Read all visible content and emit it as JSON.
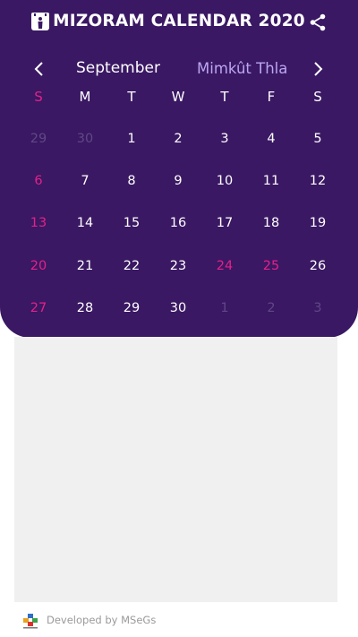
{
  "app": {
    "title": "MIZORAM CALENDAR 2020"
  },
  "nav": {
    "month_en": "September",
    "month_mz": "Mimkût Thla"
  },
  "weekdays": [
    "S",
    "M",
    "T",
    "W",
    "T",
    "F",
    "S"
  ],
  "weeks": [
    [
      {
        "d": "29",
        "t": "other"
      },
      {
        "d": "30",
        "t": "other"
      },
      {
        "d": "1",
        "t": "normal"
      },
      {
        "d": "2",
        "t": "normal"
      },
      {
        "d": "3",
        "t": "normal"
      },
      {
        "d": "4",
        "t": "normal"
      },
      {
        "d": "5",
        "t": "normal"
      }
    ],
    [
      {
        "d": "6",
        "t": "sun"
      },
      {
        "d": "7",
        "t": "normal"
      },
      {
        "d": "8",
        "t": "normal"
      },
      {
        "d": "9",
        "t": "normal"
      },
      {
        "d": "10",
        "t": "normal"
      },
      {
        "d": "11",
        "t": "normal"
      },
      {
        "d": "12",
        "t": "normal"
      }
    ],
    [
      {
        "d": "13",
        "t": "sun"
      },
      {
        "d": "14",
        "t": "normal"
      },
      {
        "d": "15",
        "t": "normal"
      },
      {
        "d": "16",
        "t": "normal"
      },
      {
        "d": "17",
        "t": "normal"
      },
      {
        "d": "18",
        "t": "normal"
      },
      {
        "d": "19",
        "t": "normal"
      }
    ],
    [
      {
        "d": "20",
        "t": "sun"
      },
      {
        "d": "21",
        "t": "normal"
      },
      {
        "d": "22",
        "t": "normal"
      },
      {
        "d": "23",
        "t": "normal"
      },
      {
        "d": "24",
        "t": "holiday"
      },
      {
        "d": "25",
        "t": "holiday"
      },
      {
        "d": "26",
        "t": "normal"
      }
    ],
    [
      {
        "d": "27",
        "t": "sun"
      },
      {
        "d": "28",
        "t": "normal"
      },
      {
        "d": "29",
        "t": "normal"
      },
      {
        "d": "30",
        "t": "normal"
      },
      {
        "d": "1",
        "t": "other"
      },
      {
        "d": "2",
        "t": "other"
      },
      {
        "d": "3",
        "t": "other"
      }
    ]
  ],
  "footer": {
    "credit": "Developed by MSeGs"
  },
  "icons": {
    "app": "calendar-app-icon",
    "share": "share-icon",
    "prev": "chevron-left-icon",
    "next": "chevron-right-icon",
    "logo": "msegs-logo-icon"
  },
  "colors": {
    "header_bg": "#3a1863",
    "accent_pink": "#e3218a",
    "muted_day": "#5f4886",
    "mizo_month": "#bba6f3",
    "ad_bg": "#f0f0f0"
  }
}
